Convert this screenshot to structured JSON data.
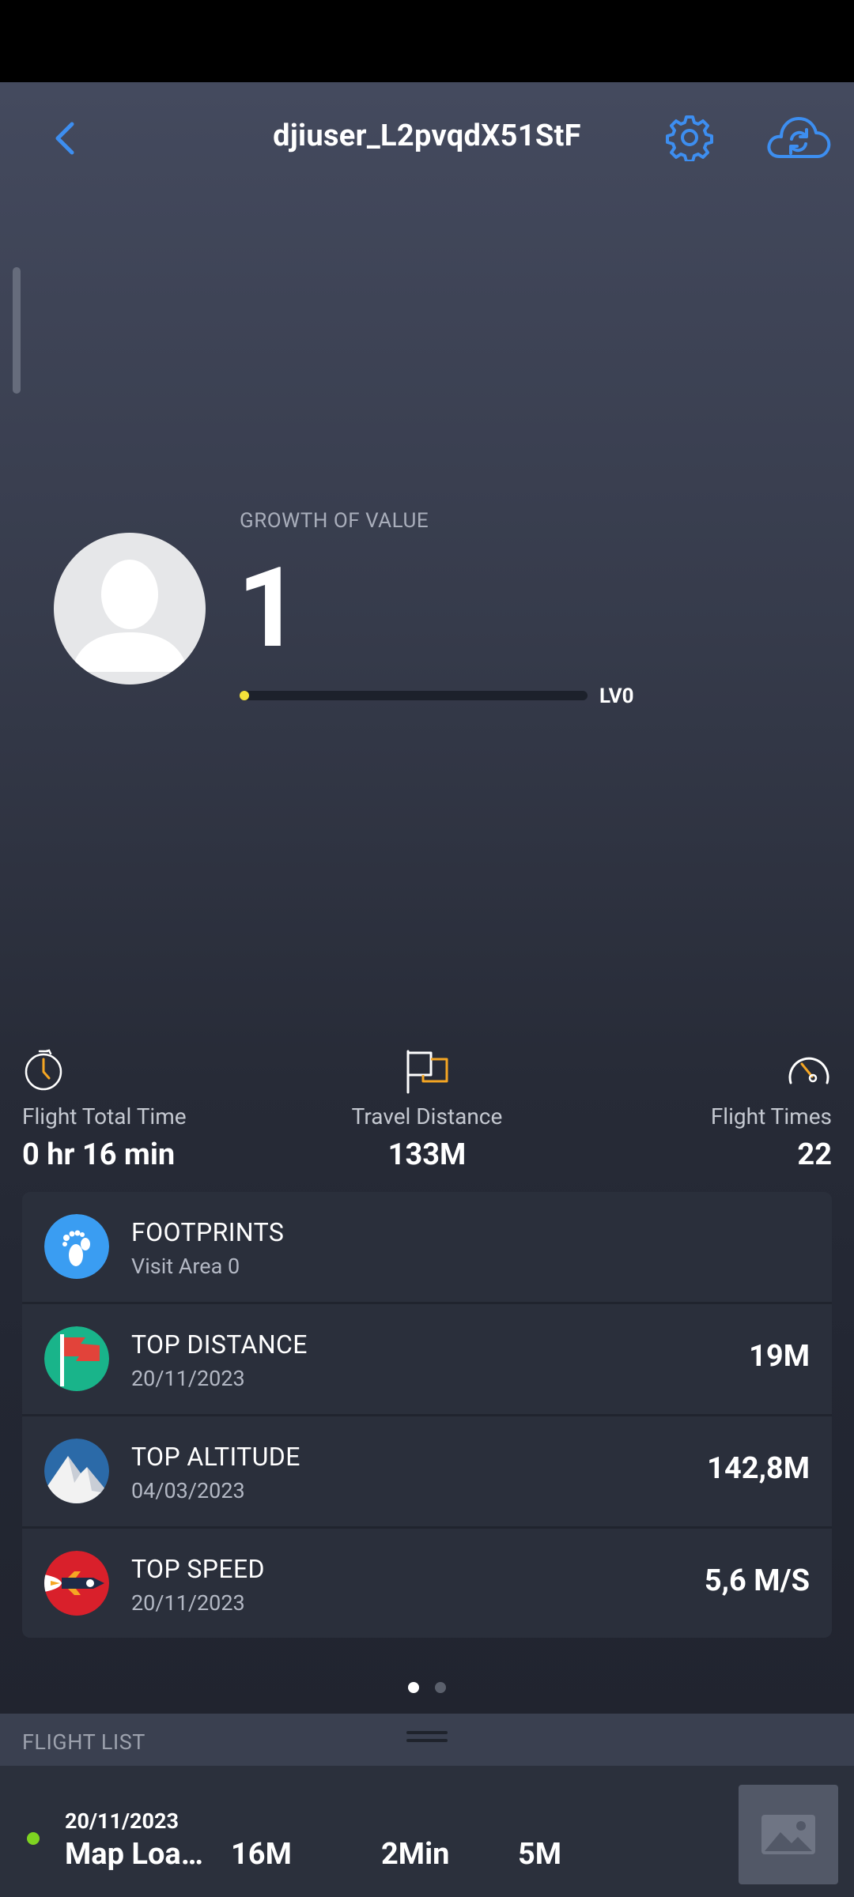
{
  "header": {
    "title": "djiuser_L2pvqdX51StF",
    "back_icon": "back-chevron-icon",
    "settings_icon": "gear-icon",
    "sync_icon": "cloud-sync-icon",
    "accent_color": "#3d8ef0"
  },
  "profile": {
    "growth_label": "GROWTH OF VALUE",
    "growth_value": "1",
    "level": "LV0",
    "progress": 0.02,
    "progress_color": "#f5e23a"
  },
  "stats": {
    "total_time": {
      "label": "Flight Total Time",
      "value": "0 hr 16 min",
      "icon": "stopwatch-icon"
    },
    "distance": {
      "label": "Travel Distance",
      "value": "133M",
      "icon": "flag-icon"
    },
    "times": {
      "label": "Flight Times",
      "value": "22",
      "icon": "speedometer-icon"
    }
  },
  "records": [
    {
      "title": "FOOTPRINTS",
      "subtitle": "Visit Area 0",
      "value": "",
      "icon": "footprints-icon",
      "color": "#3a9df2"
    },
    {
      "title": "TOP DISTANCE",
      "subtitle": "20/11/2023",
      "value": "19M",
      "icon": "red-flag-icon",
      "color": "#19b48a"
    },
    {
      "title": "TOP ALTITUDE",
      "subtitle": "04/03/2023",
      "value": "142,8M",
      "icon": "mountain-icon",
      "color": "#2b6aa8"
    },
    {
      "title": "TOP SPEED",
      "subtitle": "20/11/2023",
      "value": "5,6 M/S",
      "icon": "rocket-icon",
      "color": "#d9202b"
    }
  ],
  "pager": {
    "pages": 2,
    "active": 0
  },
  "flight_list": {
    "title": "FLIGHT LIST",
    "items": [
      {
        "date": "20/11/2023",
        "name": "Map Loa…",
        "distance": "16M",
        "duration": "2Min",
        "altitude": "5M",
        "status_color": "#7ed321"
      }
    ]
  }
}
